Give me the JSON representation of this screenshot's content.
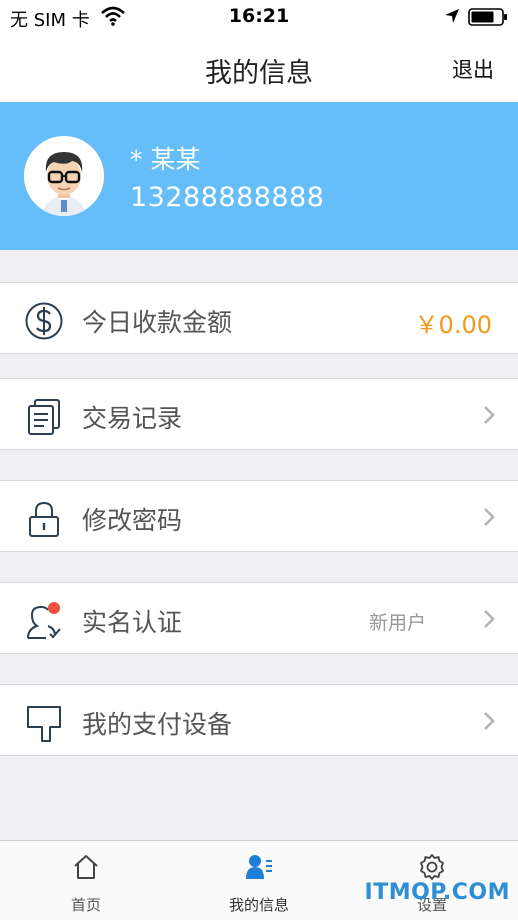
{
  "status_bar": {
    "carrier": "无 SIM 卡",
    "time": "16:21"
  },
  "nav": {
    "title": "我的信息",
    "logout_label": "退出"
  },
  "profile": {
    "name": "* 某某",
    "phone": "13288888888"
  },
  "menu": [
    {
      "label": "今日收款金额",
      "value": "￥0.00",
      "icon": "dollar-circle-icon"
    },
    {
      "label": "交易记录",
      "icon": "documents-icon"
    },
    {
      "label": "修改密码",
      "icon": "lock-icon"
    },
    {
      "label": "实名认证",
      "badge": "新用户",
      "icon": "user-verify-icon"
    },
    {
      "label": "我的支付设备",
      "icon": "device-icon"
    }
  ],
  "tabs": [
    {
      "label": "首页",
      "icon": "home-icon"
    },
    {
      "label": "我的信息",
      "icon": "profile-icon",
      "active": true
    },
    {
      "label": "设置",
      "icon": "gear-icon"
    }
  ],
  "watermark": "ITMOP.COM",
  "colors": {
    "header_blue": "#65bdfa",
    "amount_orange": "#f19a1b",
    "active_tab_blue": "#1f7fd6",
    "watermark_blue": "#2f8fd6",
    "notification_red": "#f0503c"
  }
}
